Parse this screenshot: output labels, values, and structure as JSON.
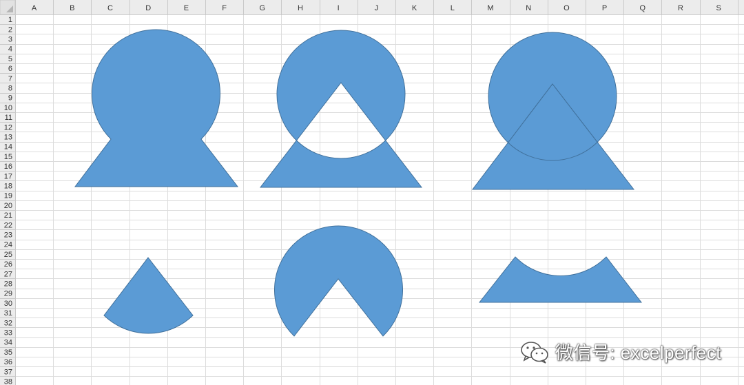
{
  "spreadsheet": {
    "column_headers": [
      "A",
      "B",
      "C",
      "D",
      "E",
      "F",
      "G",
      "H",
      "I",
      "J",
      "K",
      "L",
      "M",
      "N",
      "O",
      "P",
      "Q",
      "R",
      "S"
    ],
    "row_headers": [
      "1",
      "2",
      "3",
      "4",
      "5",
      "6",
      "7",
      "8",
      "9",
      "10",
      "11",
      "12",
      "13",
      "14",
      "15",
      "16",
      "17",
      "18",
      "19",
      "20",
      "21",
      "22",
      "23",
      "24",
      "25",
      "26",
      "27",
      "28",
      "29",
      "30",
      "31",
      "32",
      "33",
      "34",
      "35",
      "36",
      "37",
      "38"
    ]
  },
  "shapes": [
    {
      "name": "union",
      "fill": "#5b9bd5",
      "outline": "#41719c"
    },
    {
      "name": "combine",
      "fill": "#5b9bd5",
      "outline": "#41719c"
    },
    {
      "name": "fragment",
      "fill": "#5b9bd5",
      "outline": "#41719c"
    },
    {
      "name": "intersect",
      "fill": "#5b9bd5",
      "outline": "#41719c"
    },
    {
      "name": "subtract-circle",
      "fill": "#5b9bd5",
      "outline": "#41719c"
    },
    {
      "name": "subtract-triangle",
      "fill": "#5b9bd5",
      "outline": "#41719c"
    }
  ],
  "watermark": {
    "text": "微信号: excelperfect",
    "icon": "wechat-icon"
  }
}
